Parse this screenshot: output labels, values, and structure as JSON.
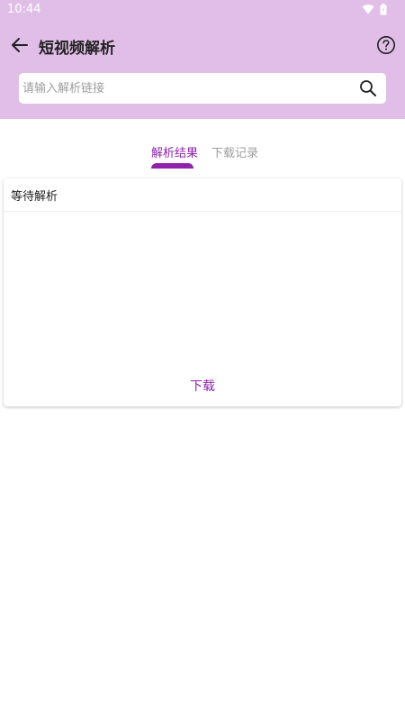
{
  "status_bar": {
    "time": "10:44",
    "icons": [
      "wifi-icon",
      "battery-icon"
    ]
  },
  "toolbar": {
    "back_icon": "arrow-left-icon",
    "title": "短视频解析",
    "help_icon": "help-circle-icon"
  },
  "search": {
    "placeholder": "请输入解析链接",
    "value": "",
    "icon": "search-icon"
  },
  "tabs": [
    {
      "label": "解析结果",
      "active": true
    },
    {
      "label": "下载记录",
      "active": false
    }
  ],
  "result_card": {
    "title": "等待解析",
    "download_label": "下载"
  },
  "colors": {
    "header_background": "#E1BEE7",
    "accent": "#8E24AA",
    "inactive_tab": "#9E9E9E"
  }
}
